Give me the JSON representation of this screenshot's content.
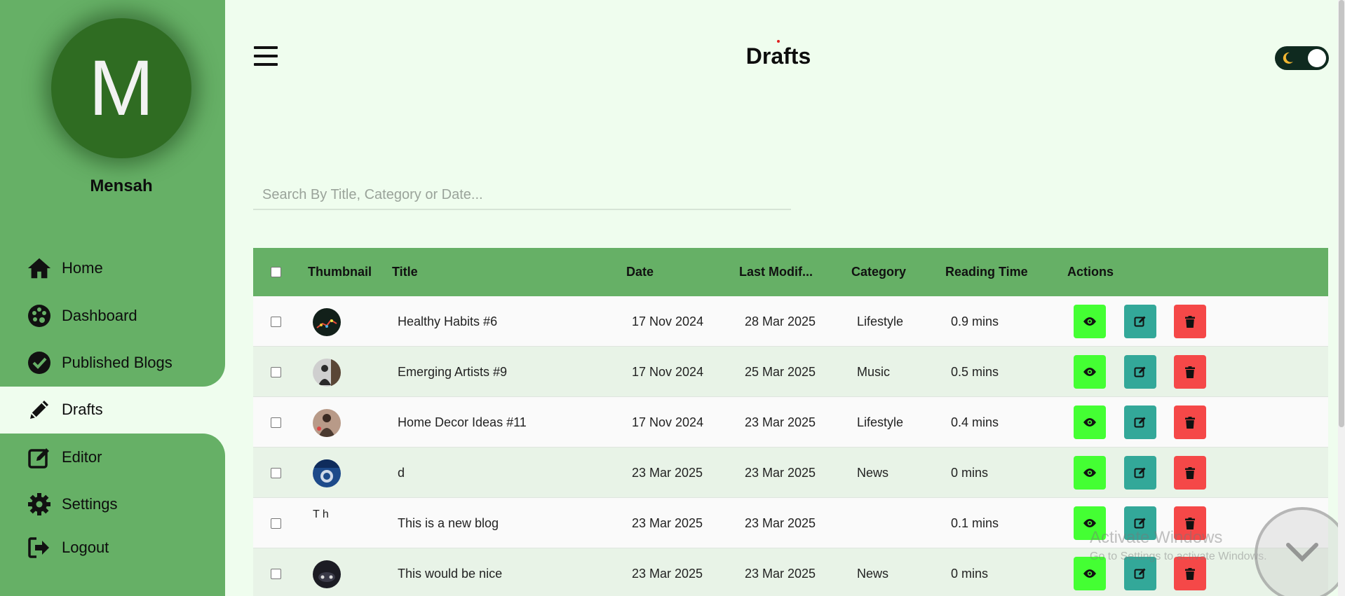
{
  "sidebar": {
    "avatar_letter": "M",
    "username": "Mensah",
    "items": [
      {
        "label": "Home",
        "icon": "home-icon"
      },
      {
        "label": "Dashboard",
        "icon": "palette-icon"
      },
      {
        "label": "Published Blogs",
        "icon": "check-circle-icon"
      },
      {
        "label": "Drafts",
        "icon": "pencil-icon",
        "active": true
      },
      {
        "label": "Editor",
        "icon": "edit-square-icon"
      },
      {
        "label": "Settings",
        "icon": "gear-icon"
      },
      {
        "label": "Logout",
        "icon": "logout-icon"
      }
    ]
  },
  "header": {
    "title": "Drafts",
    "theme_toggle": "dark-mode-toggle"
  },
  "search": {
    "placeholder": "Search By Title, Category or Date...",
    "value": ""
  },
  "table": {
    "columns": [
      "Thumbnail",
      "Title",
      "Date",
      "Last Modif...",
      "Category",
      "Reading Time",
      "Actions"
    ],
    "rows": [
      {
        "title": "Healthy Habits #6",
        "date": "17 Nov 2024",
        "modified": "28 Mar 2025",
        "category": "Lifestyle",
        "reading_time": "0.9 mins"
      },
      {
        "title": "Emerging Artists #9",
        "date": "17 Nov 2024",
        "modified": "25 Mar 2025",
        "category": "Music",
        "reading_time": "0.5 mins"
      },
      {
        "title": "Home Decor Ideas #11",
        "date": "17 Nov 2024",
        "modified": "23 Mar 2025",
        "category": "Lifestyle",
        "reading_time": "0.4 mins"
      },
      {
        "title": "d",
        "date": "23 Mar 2025",
        "modified": "23 Mar 2025",
        "category": "News",
        "reading_time": "0 mins"
      },
      {
        "title": "This is a new blog",
        "date": "23 Mar 2025",
        "modified": "23 Mar 2025",
        "category": "",
        "reading_time": "0.1 mins",
        "broken_thumb_alt": "T h"
      },
      {
        "title": "This would be nice",
        "date": "23 Mar 2025",
        "modified": "23 Mar 2025",
        "category": "News",
        "reading_time": "0 mins"
      }
    ],
    "actions": [
      "view-icon",
      "edit-icon",
      "delete-icon"
    ]
  },
  "overlay": {
    "watermark_title": "Activate Windows",
    "watermark_subtitle": "Go to Settings to activate Windows."
  },
  "colors": {
    "sidebar": "#66b066",
    "background": "#effdee",
    "avatar": "#2f6c22",
    "view": "#44ff33",
    "edit": "#33a899",
    "delete": "#f54848"
  }
}
